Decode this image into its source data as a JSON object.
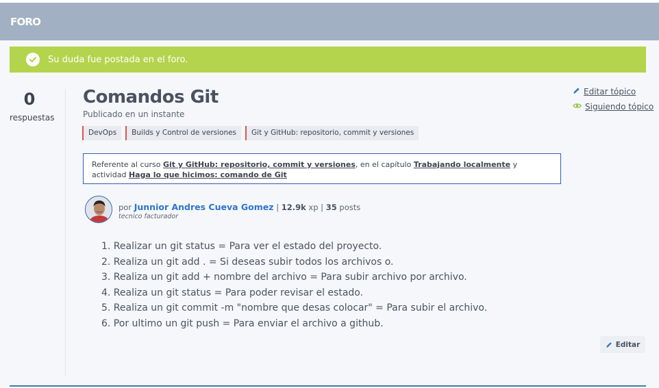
{
  "header": {
    "title": "FORO"
  },
  "alert": {
    "message": "Su duda fue postada en el foro."
  },
  "stats": {
    "count": "0",
    "label": "respuestas"
  },
  "topic": {
    "title": "Comandos Git",
    "published": "Publicado en un instante",
    "tags": [
      "DevOps",
      "Builds y Control de versiones",
      "Git y GitHub: repositorio, commit y versiones"
    ]
  },
  "reference": {
    "prefix": "Referente al curso ",
    "course": "Git y GitHub: repositorio, commit y versiones",
    "mid1": ", en el capítulo ",
    "chapter": "Trabajando localmente",
    "mid2": " y actividad ",
    "activity": "Haga lo que hicimos: comando de Git"
  },
  "author": {
    "por": "por",
    "name": "Junnior Andres Cueva Gomez",
    "xp_value": "12.9k",
    "xp_unit": "xp",
    "posts_value": "35",
    "posts_unit": "posts",
    "role": "tecnico facturador"
  },
  "post": {
    "lines": [
      "1. Realizar un git status = Para ver el estado del proyecto.",
      "2. Realiza un git add . = Si deseas subir todos los archivos o.",
      "3. Realiza un git add + nombre del archivo = Para subir archivo por archivo.",
      "4. Realiza un git status = Para poder revisar el estado.",
      "5. Realiza un git commit -m \"nombre que desas colocar\" = Para subir el archivo.",
      "6. Por ultimo un git push = Para enviar el archivo a github."
    ]
  },
  "actions": {
    "edit_topic": "Editar tópico",
    "following": "Siguiendo tópico",
    "edit": "Editar"
  },
  "icons": {
    "alert": "check-circle-icon",
    "edit_topic": "pencil-icon",
    "following": "eye-icon",
    "edit": "pencil-icon"
  },
  "colors": {
    "header_bg": "#a1b0c2",
    "alert_bg": "#b3d44c",
    "tag_accent": "#e05050",
    "author_link": "#2d76c9",
    "reference_border": "#2f5fb0",
    "edit_icon": "#2d76c9",
    "follow_icon": "#8dc63f"
  }
}
